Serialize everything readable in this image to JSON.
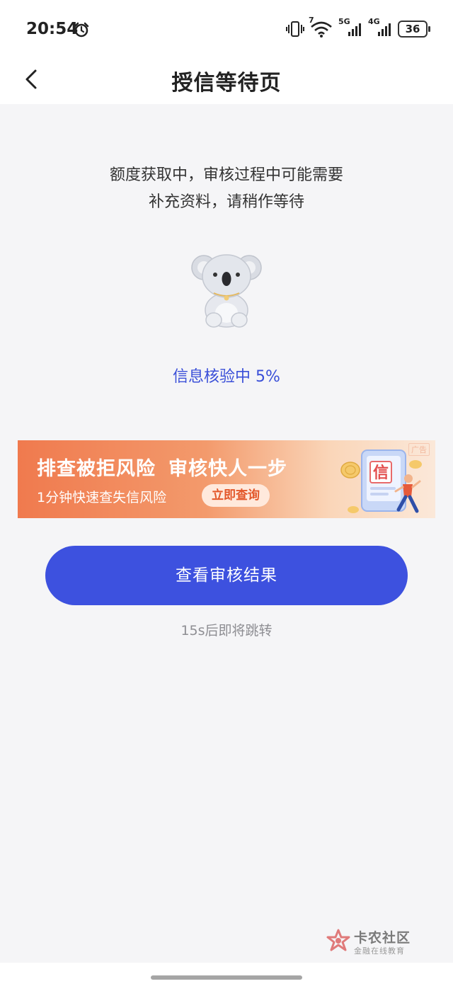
{
  "status_bar": {
    "time": "20:54",
    "battery": "36",
    "wifi_badge": "7",
    "sim1_label": "5G",
    "sim2_label": "4G"
  },
  "header": {
    "title": "授信等待页"
  },
  "message": {
    "line1": "额度获取中，审核过程中可能需要",
    "line2": "补充资料，请稍作等待"
  },
  "progress": {
    "text": "信息核验中 5%",
    "percent": 5
  },
  "banner": {
    "ad_tag": "广告",
    "title_part1": "排查被拒风险",
    "title_part2": "审核快人一步",
    "subtitle": "1分钟快速查失信风险",
    "button": "立即查询",
    "art_glyph": "信"
  },
  "actions": {
    "view_result": "查看审核结果",
    "countdown": "15s后即将跳转"
  },
  "watermark": {
    "title": "卡农社区",
    "subtitle": "金融在线教育"
  },
  "colors": {
    "accent": "#3d51df",
    "progress_text": "#3a4fd8",
    "banner_start": "#f07a4e",
    "background": "#f5f5f7"
  }
}
